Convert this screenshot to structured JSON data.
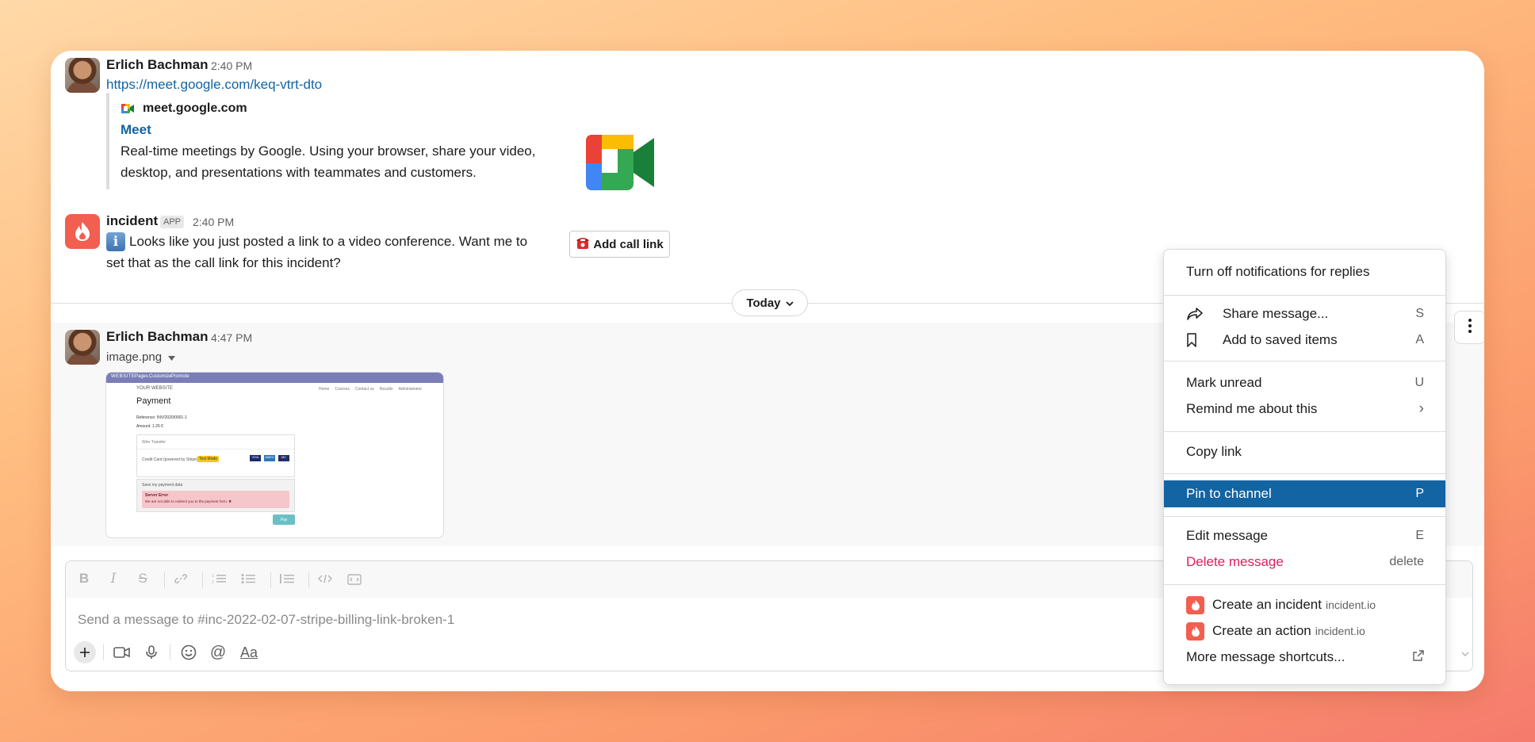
{
  "messages": [
    {
      "author": "Erlich Bachman",
      "time": "2:40 PM",
      "link": "https://meet.google.com/keq-vtrt-dto",
      "unfurl": {
        "site": "meet.google.com",
        "title": "Meet",
        "description_line1": "Real-time meetings by Google. Using your browser, share your video,",
        "description_line2": "desktop, and presentations with teammates and customers."
      }
    },
    {
      "author": "incident",
      "badge": "APP",
      "time": "2:40 PM",
      "text_line1": "Looks like you just posted a link to a video conference. Want me to",
      "text_line2": "set that as the call link for this incident?",
      "button_label": "Add call link"
    },
    {
      "author": "Erlich Bachman",
      "time": "4:47 PM",
      "filename": "image.png",
      "attachment": {
        "title": "Payment",
        "nav_items": [
          "WEBSITE",
          "Pages",
          "Customize",
          "Promote"
        ],
        "site_nav": [
          "Home",
          "Courses",
          "Contact us",
          "Results",
          "Administrator"
        ],
        "brand": "YOUR WEBSITE",
        "reference": "Reference: INV/2020/0001-1",
        "amount": "Amount: 1.26 €",
        "option_wire": "Wire Transfer",
        "option_card": "Credit Card (powered by Stripe)",
        "test_badge": "Test Mode",
        "save_label": "Save my payment data",
        "error_title": "Server Error",
        "error_text": "We are not able to redirect you to the payment form. ✖",
        "pay_label": "Pay",
        "card_brands": [
          "VISA",
          "AMEX",
          "MC"
        ]
      }
    }
  ],
  "date_divider": "Today",
  "composer": {
    "placeholder": "Send a message to #inc-2022-02-07-stripe-billing-link-broken-1"
  },
  "context_menu": {
    "items": [
      {
        "label": "Turn off notifications for replies",
        "shortcut": ""
      },
      {
        "label": "Share message...",
        "shortcut": "S",
        "icon": "share-icon"
      },
      {
        "label": "Add to saved items",
        "shortcut": "A",
        "icon": "bookmark-icon"
      },
      {
        "label": "Mark unread",
        "shortcut": "U"
      },
      {
        "label": "Remind me about this",
        "shortcut": "›"
      },
      {
        "label": "Copy link",
        "shortcut": ""
      },
      {
        "label": "Pin to channel",
        "shortcut": "P",
        "selected": true
      },
      {
        "label": "Edit message",
        "shortcut": "E"
      },
      {
        "label": "Delete message",
        "shortcut": "delete",
        "danger": true
      },
      {
        "label": "Create an incident",
        "suffix": "incident.io"
      },
      {
        "label": "Create an action",
        "suffix": "incident.io"
      },
      {
        "label": "More message shortcuts...",
        "icon": "external-link-icon"
      }
    ]
  },
  "colors": {
    "link": "#1264a3",
    "selected": "#1264a3",
    "danger": "#e01e5a",
    "incident_brand": "#f25e4f"
  }
}
